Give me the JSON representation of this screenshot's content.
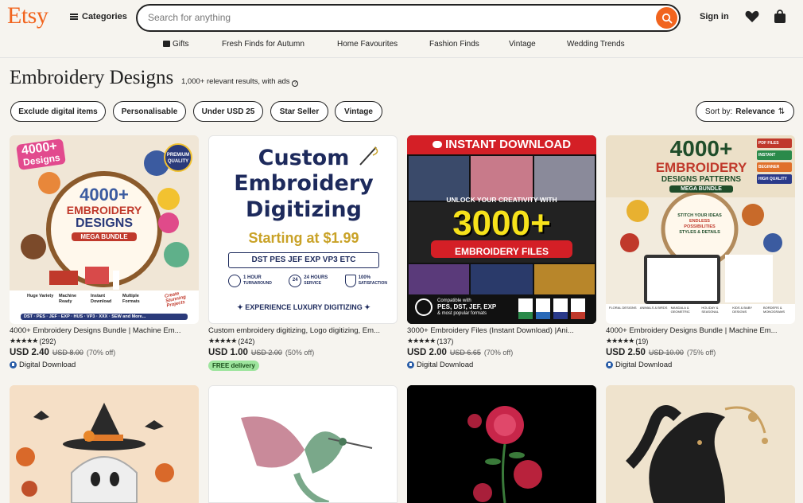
{
  "header": {
    "logo": "Etsy",
    "categories": "Categories",
    "search_placeholder": "Search for anything",
    "signin": "Sign in",
    "icons": [
      "menu-icon",
      "search-icon",
      "heart-icon",
      "bag-icon"
    ]
  },
  "nav": {
    "items": [
      "Gifts",
      "Fresh Finds for Autumn",
      "Home Favourites",
      "Fashion Finds",
      "Vintage",
      "Wedding Trends"
    ]
  },
  "page": {
    "title": "Embroidery Designs",
    "results": "1,000+ relevant results, with ads"
  },
  "filters": [
    "Exclude digital items",
    "Personalisable",
    "Under USD 25",
    "Star Seller",
    "Vintage"
  ],
  "sort": {
    "label": "Sort by:",
    "value": "Relevance"
  },
  "products": [
    {
      "title": "4000+ Embroidery Designs Bundle | Machine Em...",
      "stars": "★★★★★",
      "reviews": "(292)",
      "price": "USD 2.40",
      "orig": "USD 8.00",
      "disc": "(70% off)",
      "tag": "Digital Download"
    },
    {
      "title": "Custom embroidery digitizing, Logo digitizing, Em...",
      "stars": "★★★★★",
      "reviews": "(242)",
      "price": "USD 1.00",
      "orig": "USD 2.00",
      "disc": "(50% off)",
      "tag": "FREE delivery"
    },
    {
      "title": "3000+ Embroidery Files (Instant Download) |Ani...",
      "stars": "★★★★★",
      "reviews": "(137)",
      "price": "USD 2.00",
      "orig": "USD 6.65",
      "disc": "(70% off)",
      "tag": "Digital Download"
    },
    {
      "title": "4000+ Embroidery Designs Bundle | Machine Em...",
      "stars": "★★★★★",
      "reviews": "(19)",
      "price": "USD 2.50",
      "orig": "USD 10.00",
      "disc": "(75% off)",
      "tag": "Digital Download"
    }
  ],
  "thumbs": {
    "t1": {
      "a": "4000+",
      "b": "Designs",
      "c": "4000+",
      "d": "EMBROIDERY",
      "e": "DESIGNS",
      "f": "MEGA BUNDLE",
      "g": "PREMIUM QUALITY",
      "h": "DST · PES · JEF · EXP · HUS · VP3 · XXX · SEW and More...",
      "badges": [
        "Huge Variety",
        "Machine Ready",
        "Instant Download",
        "Multiple Formats"
      ],
      "stamp": "Create Stunning Projects"
    },
    "t2": {
      "a": "Custom",
      "b": "Embroidery",
      "c": "Digitizing",
      "d": "Starting at $1.99",
      "e": "DST  PES  JEF  EXP  VP3  ETC",
      "f1": "1 HOUR",
      "f1s": "TURNAROUND",
      "f2": "24 HOURS",
      "f2s": "SERVICE",
      "f3": "100%",
      "f3s": "SATISFACTION",
      "g": "EXPERIENCE LUXURY DIGITIZING",
      "badge24": "24"
    },
    "t3": {
      "a": "INSTANT DOWNLOAD",
      "b": "UNLOCK YOUR CREATIVITY WITH",
      "c": "3000+",
      "d": "EMBROIDERY FILES",
      "e": "Compatible with",
      "f": "PES, DST, JEF, EXP",
      "g": "& most popular formats",
      "formats": [
        "PES",
        "DST",
        "JEF",
        "EXP"
      ]
    },
    "t4": {
      "a": "4000+",
      "b": "EMBROIDERY",
      "c": "DESIGNS PATTERNS",
      "d": "MEGA BUNDLE",
      "e": "STITCH YOUR IDEAS",
      "f": "ENDLESS POSSIBILITIES",
      "g": "STYLES & DETAILS",
      "side": [
        "PDF FILES",
        "INSTANT",
        "BEGINNER",
        "HIGH QUALITY"
      ],
      "cats": [
        "FLORAL DESIGNS",
        "ANIMALS & BIRDS",
        "MANDALA & GEOMETRIC",
        "HOLIDAY & SEASONAL",
        "KIDS & BABY DESIGNS",
        "BORDERS & MONOGRAMS"
      ]
    }
  }
}
